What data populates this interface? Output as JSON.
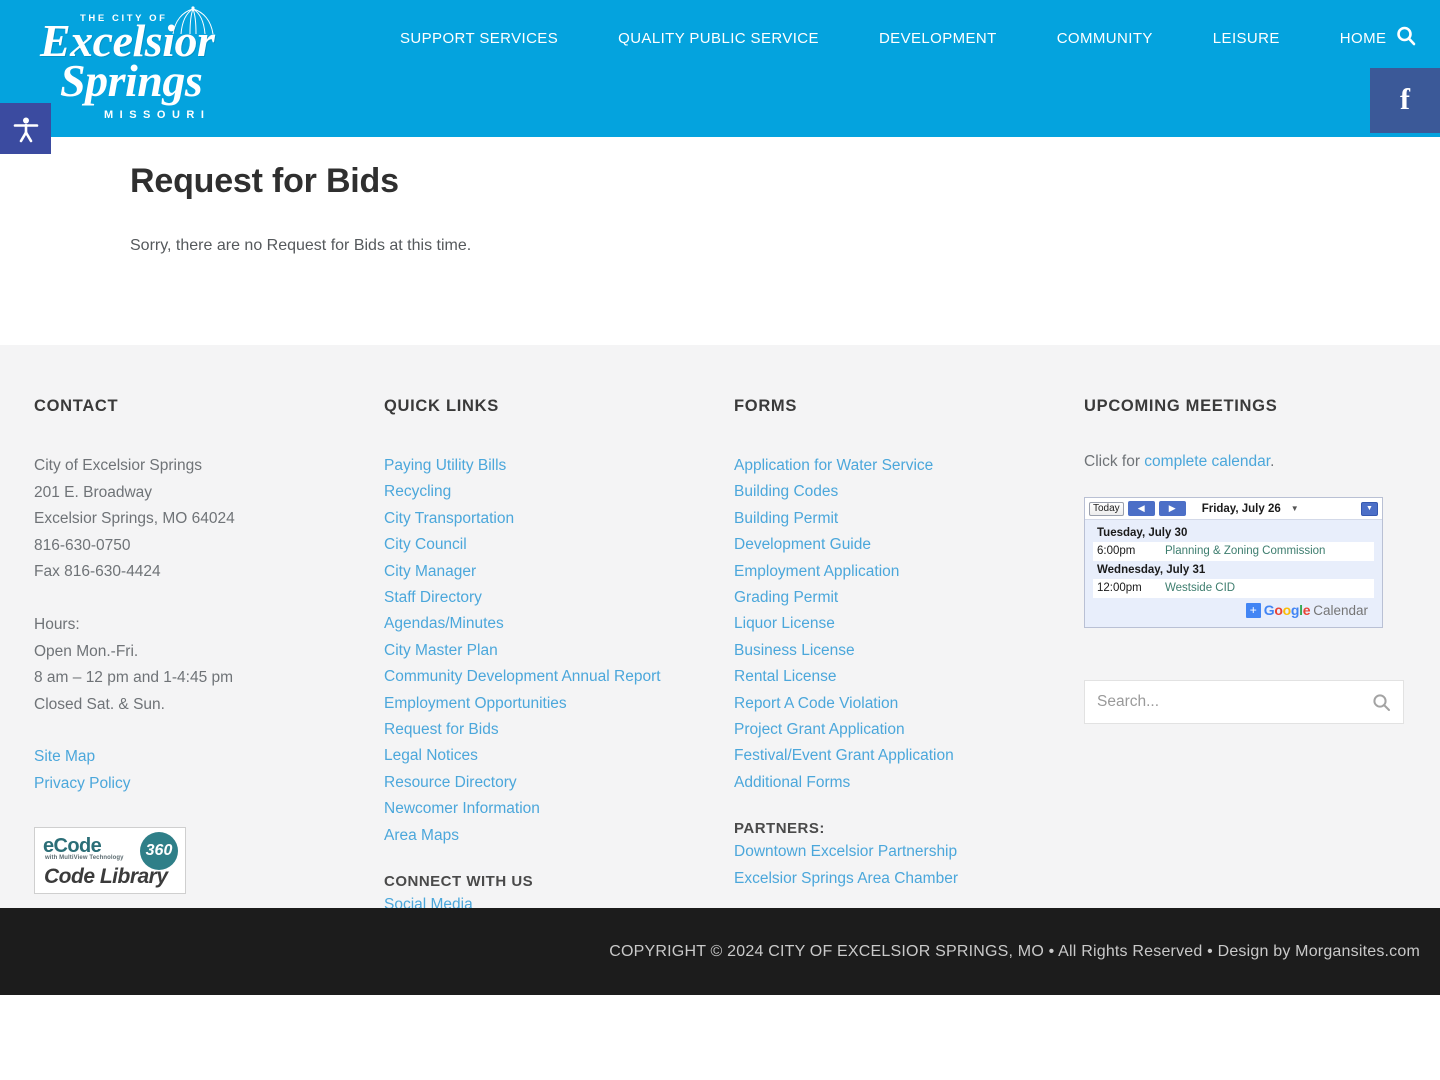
{
  "brand": {
    "logo_line_top": "THE CITY OF",
    "logo_line_1": "Excelsior",
    "logo_line_2": "Springs",
    "logo_line_3": "MISSOURI",
    "header_blue": "#04a3de",
    "facebook_blue": "#3b5998",
    "accessibility_blue": "#3b4ba0",
    "link_blue": "#4ba7db"
  },
  "nav": {
    "items": [
      {
        "label": "SUPPORT SERVICES"
      },
      {
        "label": "QUALITY PUBLIC SERVICE"
      },
      {
        "label": "DEVELOPMENT"
      },
      {
        "label": "COMMUNITY"
      },
      {
        "label": "LEISURE"
      },
      {
        "label": "HOME"
      }
    ],
    "search_icon": "search-icon",
    "facebook_icon": "facebook-icon",
    "facebook_glyph": "f",
    "accessibility_icon": "accessibility-person-icon"
  },
  "main": {
    "title": "Request for Bids",
    "body": "Sorry, there are no Request for Bids at this time."
  },
  "footer": {
    "contact": {
      "heading": "CONTACT",
      "lines": [
        "City of Excelsior Springs",
        "201 E. Broadway",
        "Excelsior Springs, MO 64024",
        "816-630-0750",
        "Fax 816-630-4424"
      ],
      "hours": [
        "Hours:",
        "Open Mon.-Fri.",
        "8 am – 12 pm and 1-4:45 pm",
        "Closed Sat. & Sun."
      ],
      "links": [
        {
          "label": "Site Map"
        },
        {
          "label": "Privacy Policy"
        }
      ],
      "ecode_badge": {
        "word": "eCode",
        "number": "360",
        "tagline": "with MultiView Technology",
        "library": "Code Library"
      }
    },
    "quick_links": {
      "heading": "QUICK LINKS",
      "links": [
        {
          "label": "Paying Utility Bills"
        },
        {
          "label": "Recycling"
        },
        {
          "label": "City Transportation"
        },
        {
          "label": "City Council"
        },
        {
          "label": "City Manager"
        },
        {
          "label": "Staff Directory"
        },
        {
          "label": "Agendas/Minutes"
        },
        {
          "label": "City Master Plan"
        },
        {
          "label": "Community Development Annual Report"
        },
        {
          "label": "Employment Opportunities"
        },
        {
          "label": "Request for Bids"
        },
        {
          "label": "Legal Notices"
        },
        {
          "label": "Resource Directory"
        },
        {
          "label": "Newcomer Information"
        },
        {
          "label": "Area Maps"
        }
      ],
      "connect_heading": "CONNECT WITH US",
      "connect_links": [
        {
          "label": "Social Media"
        }
      ]
    },
    "forms": {
      "heading": "FORMS",
      "links": [
        {
          "label": "Application for Water Service"
        },
        {
          "label": "Building Codes"
        },
        {
          "label": "Building Permit"
        },
        {
          "label": "Development Guide"
        },
        {
          "label": "Employment Application"
        },
        {
          "label": "Grading Permit"
        },
        {
          "label": "Liquor License"
        },
        {
          "label": "Business License"
        },
        {
          "label": "Rental License"
        },
        {
          "label": "Report A Code Violation"
        },
        {
          "label": "Project Grant Application"
        },
        {
          "label": "Festival/Event Grant Application"
        },
        {
          "label": "Additional Forms"
        }
      ],
      "partners_heading": "PARTNERS:",
      "partners": [
        {
          "label": "Downtown Excelsior Partnership"
        },
        {
          "label": "Excelsior Springs Area Chamber"
        }
      ]
    },
    "meetings": {
      "heading": "UPCOMING MEETINGS",
      "intro_prefix": "Click for ",
      "intro_link": "complete calendar",
      "intro_suffix": ".",
      "calendar": {
        "today_label": "Today",
        "prev_glyph": "◀",
        "next_glyph": "▶",
        "current_date": "Friday, July 26",
        "dropdown_caret": "▼",
        "selector_caret": "▼",
        "days": [
          {
            "label": "Tuesday, July 30",
            "events": [
              {
                "time": "6:00pm",
                "name": "Planning & Zoning Commission"
              }
            ]
          },
          {
            "label": "Wednesday, July 31",
            "events": [
              {
                "time": "12:00pm",
                "name": "Westside CID"
              }
            ]
          }
        ],
        "footer_plus": "+",
        "footer_brand_g": "G",
        "footer_brand_o1": "o",
        "footer_brand_o2": "o",
        "footer_brand_g2": "g",
        "footer_brand_l": "l",
        "footer_brand_e": "e",
        "footer_word": "Calendar"
      },
      "search_placeholder": "Search...",
      "search_value": "",
      "search_icon": "search-icon"
    },
    "copyright": "COPYRIGHT © 2024 CITY OF EXCELSIOR SPRINGS, MO • All Rights Reserved • Design by Morgansites.com"
  }
}
